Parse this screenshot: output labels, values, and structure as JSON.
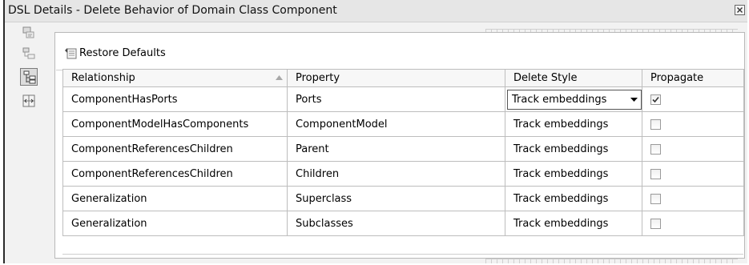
{
  "window": {
    "title": "DSL Details - Delete Behavior of Domain Class Component"
  },
  "side_toolbar": {
    "tools": [
      {
        "icon": "class-data-icon",
        "active": false
      },
      {
        "icon": "shape-map-icon",
        "active": false
      },
      {
        "icon": "delete-behavior-icon",
        "active": true
      },
      {
        "icon": "serialization-icon",
        "active": false
      }
    ]
  },
  "toolbar": {
    "restore_label": "Restore Defaults"
  },
  "grid": {
    "headers": {
      "relationship": "Relationship",
      "property": "Property",
      "delete_style": "Delete Style",
      "propagate": "Propagate"
    },
    "sort_column": "relationship",
    "rows": [
      {
        "relationship": "ComponentHasPorts",
        "property": "Ports",
        "delete_style": "Track embeddings",
        "propagate": true,
        "editing": true
      },
      {
        "relationship": "ComponentModelHasComponents",
        "property": "ComponentModel",
        "delete_style": "Track embeddings",
        "propagate": false,
        "editing": false
      },
      {
        "relationship": "ComponentReferencesChildren",
        "property": "Parent",
        "delete_style": "Track embeddings",
        "propagate": false,
        "editing": false
      },
      {
        "relationship": "ComponentReferencesChildren",
        "property": "Children",
        "delete_style": "Track embeddings",
        "propagate": false,
        "editing": false
      },
      {
        "relationship": "Generalization",
        "property": "Superclass",
        "delete_style": "Track embeddings",
        "propagate": false,
        "editing": false
      },
      {
        "relationship": "Generalization",
        "property": "Subclasses",
        "delete_style": "Track embeddings",
        "propagate": false,
        "editing": false
      }
    ]
  }
}
